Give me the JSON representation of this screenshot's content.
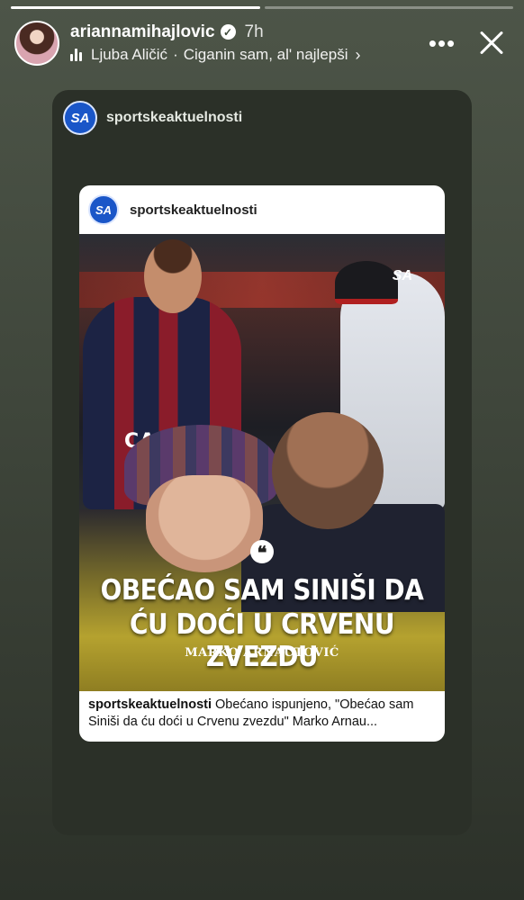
{
  "progress": [
    {
      "fill": 1.0
    },
    {
      "fill": 0.0
    }
  ],
  "header": {
    "username": "ariannamihajlovic",
    "verified_icon": "check",
    "time": "7h",
    "music": {
      "artist": "Ljuba Aličić",
      "separator": "·",
      "song": "Ciganin sam, al' najlepši",
      "chevron": "›"
    },
    "more_label": "•••"
  },
  "frame": {
    "account": "sportskeaktuelnosti",
    "logo_text": "SA"
  },
  "post": {
    "account": "sportskeaktuelnosti",
    "logo_text": "SA",
    "watermark": "SA",
    "sponsor_text": "CAZOO",
    "quote_glyph": "❝",
    "headline_line1": "OBEĆAO SAM SINIŠI DA",
    "headline_line2": "ĆU DOĆI U CRVENU ZVEZDU",
    "author": "MARKO ARNAUTOVIĆ",
    "caption_account": "sportskeaktuelnosti",
    "caption_text": " Obećano ispunjeno, \"Obećao sam Siniši da ću doći u Crvenu zvezdu\" Marko Arnau..."
  },
  "colors": {
    "background": "#4d5548",
    "sa_blue": "#1a56c8",
    "bologna_red": "#8a1c2a",
    "bologna_navy": "#1c2344"
  }
}
